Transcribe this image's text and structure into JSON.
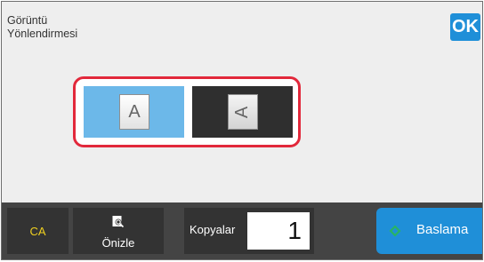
{
  "header": {
    "title_line1": "Görüntü",
    "title_line2": "Yönlendirmesi",
    "ok_label": "OK"
  },
  "orientation": {
    "options": [
      {
        "id": "portrait",
        "glyph": "A",
        "selected": true
      },
      {
        "id": "landscape",
        "glyph": "A",
        "selected": false
      }
    ],
    "colors": {
      "selected": "#6cb8e9",
      "unselected": "#2f2f2f",
      "group_border": "#e2283b"
    }
  },
  "footer": {
    "ca_label": "CA",
    "preview_label": "Önizle",
    "preview_icon": "magnifier-document-icon",
    "copies_label": "Kopyalar",
    "copies_value": "1",
    "start_label": "Baslama",
    "start_icon": "start-diamond-icon"
  },
  "colors": {
    "accent": "#1f8fd8",
    "ca_text": "#f0d020",
    "start_icon": "#28b463"
  }
}
